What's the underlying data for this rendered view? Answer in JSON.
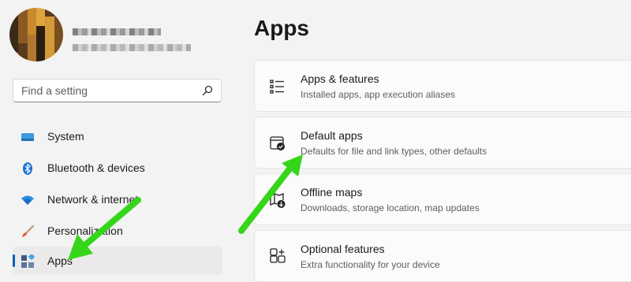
{
  "sidebar": {
    "search_placeholder": "Find a setting",
    "items": [
      {
        "label": "System",
        "icon": "monitor-icon"
      },
      {
        "label": "Bluetooth & devices",
        "icon": "bluetooth-icon"
      },
      {
        "label": "Network & internet",
        "icon": "wifi-icon"
      },
      {
        "label": "Personalization",
        "icon": "brush-icon"
      },
      {
        "label": "Apps",
        "icon": "apps-icon",
        "selected": true
      }
    ]
  },
  "main": {
    "title": "Apps",
    "cards": [
      {
        "title": "Apps & features",
        "subtitle": "Installed apps, app execution aliases",
        "icon": "list-icon"
      },
      {
        "title": "Default apps",
        "subtitle": "Defaults for file and link types, other defaults",
        "icon": "default-apps-icon"
      },
      {
        "title": "Offline maps",
        "subtitle": "Downloads, storage location, map updates",
        "icon": "map-download-icon"
      },
      {
        "title": "Optional features",
        "subtitle": "Extra functionality for your device",
        "icon": "add-feature-icon"
      }
    ]
  },
  "colors": {
    "accent": "#005fb8",
    "annotation_arrow": "#35d61a"
  }
}
